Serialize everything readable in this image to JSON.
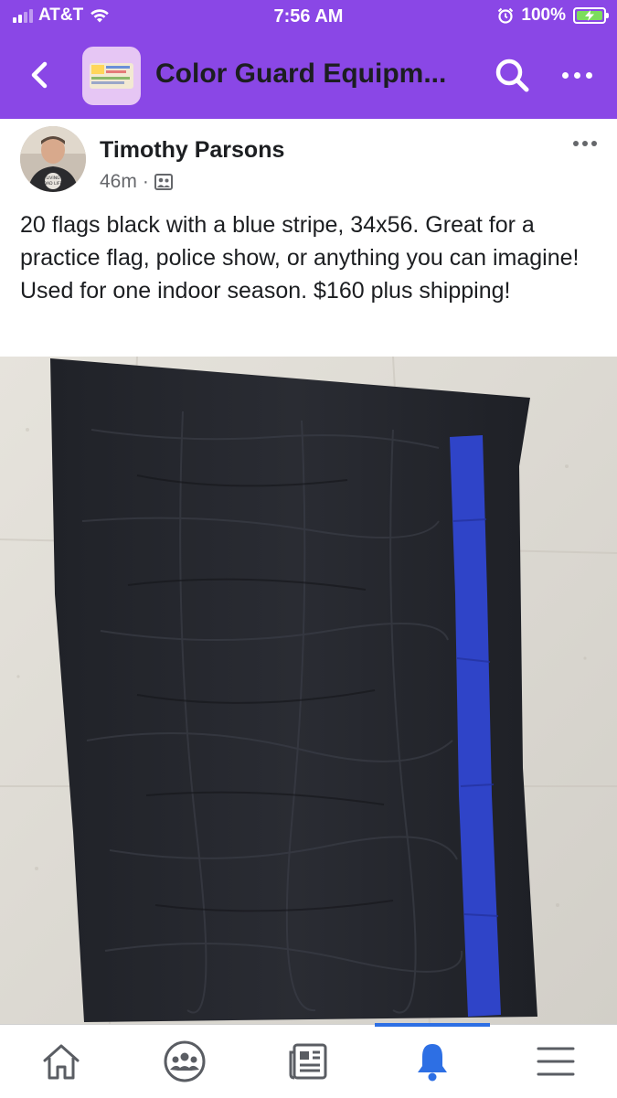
{
  "status_bar": {
    "carrier": "AT&T",
    "time": "7:56 AM",
    "battery": "100%",
    "icons": [
      "signal-bars-icon",
      "wifi-icon",
      "alarm-icon",
      "battery-charging-icon"
    ]
  },
  "nav": {
    "title": "Color Guard Equipm...",
    "back_icon": "chevron-left-icon",
    "search_icon": "search-icon",
    "more_icon": "more-dots-icon"
  },
  "post": {
    "author": "Timothy Parsons",
    "time": "46m",
    "separator": "·",
    "audience_icon": "group-members-icon",
    "text": "20 flags black with a blue stripe, 34x56. Great for a practice flag, police show, or anything you can imagine! Used for one indoor season.  $160 plus shipping!",
    "image": "black flag with a vertical blue stripe on a tiled floor"
  },
  "tabs": [
    {
      "name": "home",
      "icon": "home-icon"
    },
    {
      "name": "groups",
      "icon": "groups-icon"
    },
    {
      "name": "news",
      "icon": "news-feed-icon"
    },
    {
      "name": "notifications",
      "icon": "bell-icon",
      "active": true
    },
    {
      "name": "menu",
      "icon": "hamburger-menu-icon"
    }
  ],
  "colors": {
    "brand_purple": "#8a47e6",
    "active_blue": "#2d6fe4",
    "flag_black": "#1d1f24",
    "stripe_blue": "#2f44c8"
  }
}
